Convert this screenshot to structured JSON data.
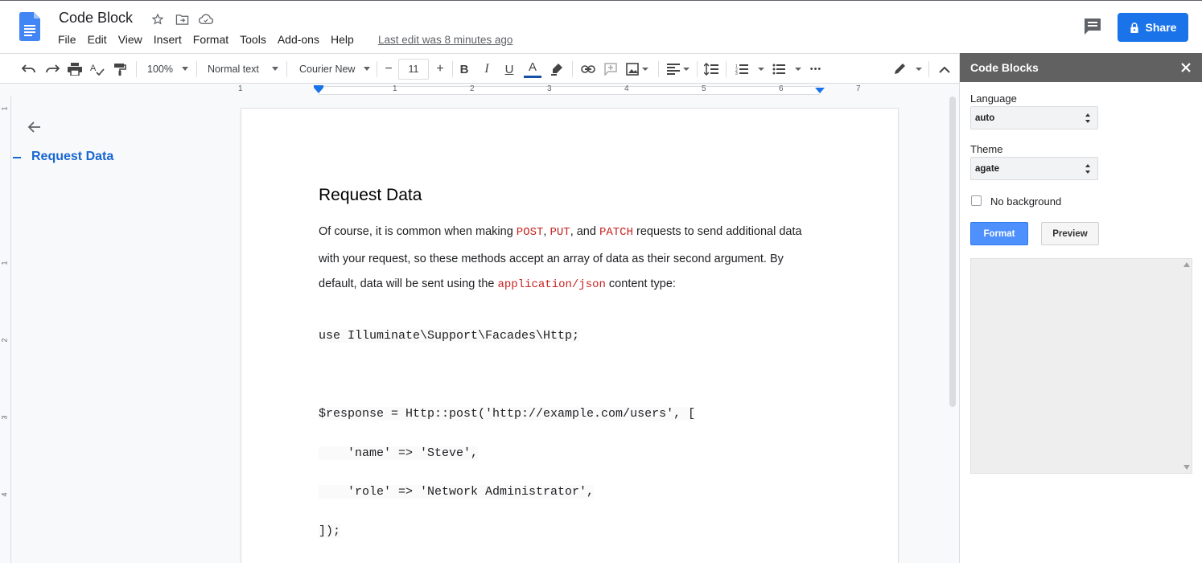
{
  "app": {
    "doc_title": "Code Block",
    "menu": [
      "File",
      "Edit",
      "View",
      "Insert",
      "Format",
      "Tools",
      "Add-ons",
      "Help"
    ],
    "last_edit": "Last edit was 8 minutes ago",
    "share_label": "Share",
    "brand_color": "#1a73e8"
  },
  "toolbar": {
    "zoom": "100%",
    "style": "Normal text",
    "font": "Courier New",
    "font_size": "11",
    "minus": "−",
    "plus": "+",
    "bold": "B",
    "italic": "I",
    "underline": "U",
    "text_color": "A",
    "more": "•••"
  },
  "ruler": {
    "numbers": [
      "1",
      "1",
      "2",
      "3",
      "4",
      "5",
      "6",
      "7"
    ]
  },
  "vruler": {
    "numbers": [
      "1",
      "1",
      "2",
      "3",
      "4"
    ]
  },
  "outline": {
    "items": [
      "Request Data"
    ]
  },
  "document": {
    "heading": "Request Data",
    "para1_a": "Of course, it is common when making ",
    "post": "POST",
    "comma1": ", ",
    "put": "PUT",
    "and": ", and ",
    "patch": "PATCH",
    "para1_b": " requests to send additional data",
    "para2": "with your request, so these methods accept an array of data as their second argument. By",
    "para3_a": "default, data will be sent using the ",
    "json": "application/json",
    "para3_b": " content type:",
    "code_lines": [
      "use Illuminate\\Support\\Facades\\Http;",
      "$response = Http::post('http://example.com/users', [",
      "    'name' => 'Steve',",
      "    'role' => 'Network Administrator',",
      "]);"
    ]
  },
  "sidebar": {
    "title": "Code Blocks",
    "language_label": "Language",
    "language_value": "auto",
    "theme_label": "Theme",
    "theme_value": "agate",
    "no_background_label": "No background",
    "format_label": "Format",
    "preview_label": "Preview"
  }
}
